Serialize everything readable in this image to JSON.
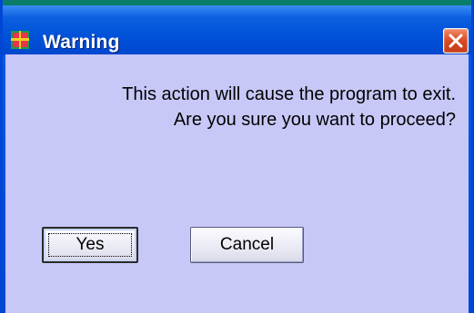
{
  "window": {
    "title": "Warning",
    "icon": "app-icon",
    "close_icon": "close-icon"
  },
  "message": {
    "line1": "This action will cause the program to exit.",
    "line2": "Are you sure you want to proceed?"
  },
  "buttons": {
    "yes_label": "Yes",
    "cancel_label": "Cancel"
  },
  "colors": {
    "titlebar": "#0052d9",
    "client_background": "#c8c8f8",
    "close_button": "#d84a22"
  }
}
